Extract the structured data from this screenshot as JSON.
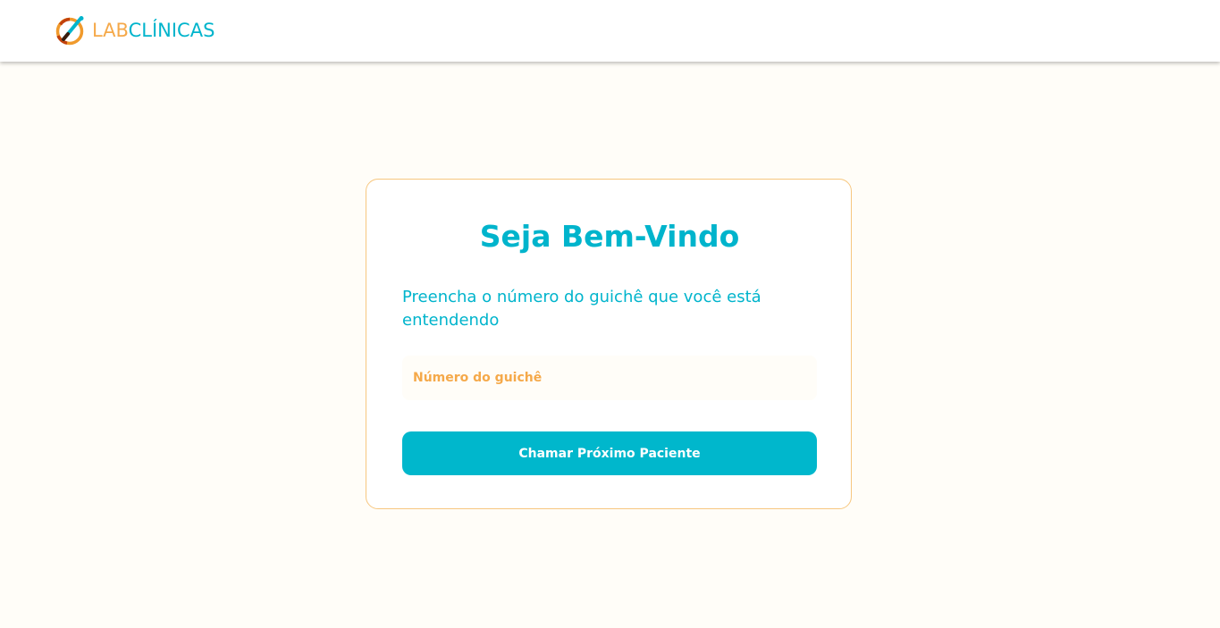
{
  "header": {
    "logo": {
      "icon": "labclinicas-logo-icon",
      "part1": "LAB",
      "part2": "CLÍNICAS"
    }
  },
  "card": {
    "title": "Seja Bem-Vindo",
    "instructions": "Preencha o número do guichê que você está entendendo",
    "input": {
      "value": "",
      "placeholder": "Número do guichê"
    },
    "button_label": "Chamar Próximo Paciente"
  },
  "colors": {
    "primary": "#00b4cc",
    "accent": "#f5a94a",
    "background": "#fffdf8",
    "card_border": "#f7c77f"
  }
}
